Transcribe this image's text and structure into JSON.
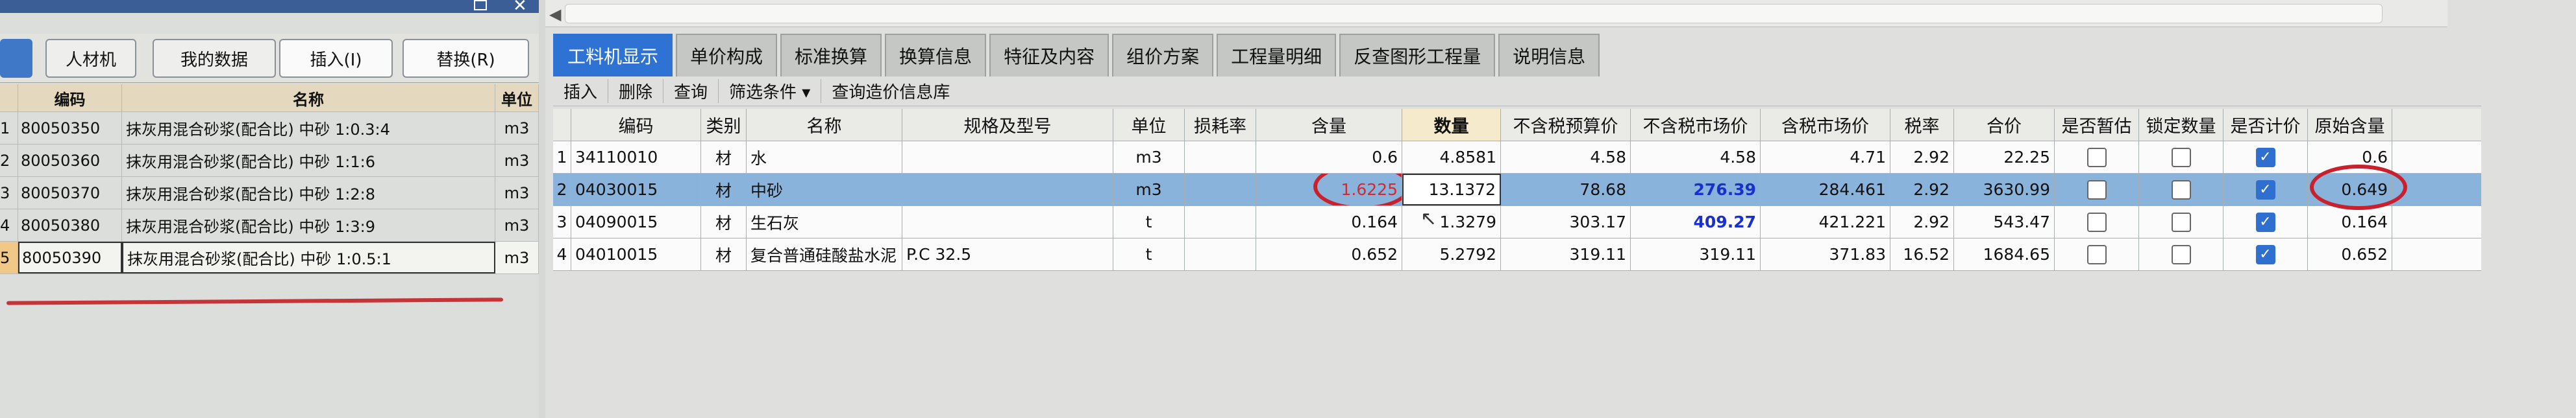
{
  "left": {
    "tabs": [
      "",
      "人材机",
      "我的数据",
      "插入(I)",
      "替换(R)"
    ],
    "columns": [
      "",
      "编码",
      "名称",
      "单位"
    ],
    "rows": [
      {
        "idx": "1",
        "code": "80050350",
        "name": "抹灰用混合砂浆(配合比) 中砂 1:0.3:4",
        "unit": "m3"
      },
      {
        "idx": "2",
        "code": "80050360",
        "name": "抹灰用混合砂浆(配合比) 中砂 1:1:6",
        "unit": "m3"
      },
      {
        "idx": "3",
        "code": "80050370",
        "name": "抹灰用混合砂浆(配合比) 中砂 1:2:8",
        "unit": "m3"
      },
      {
        "idx": "4",
        "code": "80050380",
        "name": "抹灰用混合砂浆(配合比) 中砂 1:3:9",
        "unit": "m3"
      },
      {
        "idx": "5",
        "code": "80050390",
        "name": "抹灰用混合砂浆(配合比) 中砂 1:0.5:1",
        "unit": "m3"
      }
    ]
  },
  "tabs": [
    "工料机显示",
    "单价构成",
    "标准换算",
    "换算信息",
    "特征及内容",
    "组价方案",
    "工程量明细",
    "反查图形工程量",
    "说明信息"
  ],
  "toolbar": [
    "插入",
    "删除",
    "查询",
    "筛选条件 ▾",
    "查询造价信息库"
  ],
  "columns": [
    "",
    "编码",
    "类别",
    "名称",
    "规格及型号",
    "单位",
    "损耗率",
    "含量",
    "数量",
    "不含税预算价",
    "不含税市场价",
    "含税市场价",
    "税率",
    "合价",
    "是否暂估",
    "锁定数量",
    "是否计价",
    "原始含量"
  ],
  "rows": [
    {
      "idx": "1",
      "code": "34110010",
      "type": "材",
      "name": "水",
      "spec": "",
      "unit": "m3",
      "loss": "",
      "content": "0.6",
      "qty": "4.8581",
      "pre_tax_budget": "4.58",
      "pre_tax_market": "4.58",
      "tax_market": "4.71",
      "tax_rate": "2.92",
      "total": "22.25",
      "provisional": false,
      "locked": false,
      "priced": true,
      "orig_content": "0.6"
    },
    {
      "idx": "2",
      "code": "04030015",
      "type": "材",
      "name": "中砂",
      "spec": "",
      "unit": "m3",
      "loss": "",
      "content": "1.6225",
      "qty": "13.1372",
      "pre_tax_budget": "78.68",
      "pre_tax_market": "276.39",
      "tax_market": "284.461",
      "tax_rate": "2.92",
      "total": "3630.99",
      "provisional": false,
      "locked": false,
      "priced": true,
      "orig_content": "0.649"
    },
    {
      "idx": "3",
      "code": "04090015",
      "type": "材",
      "name": "生石灰",
      "spec": "",
      "unit": "t",
      "loss": "",
      "content": "0.164",
      "qty": "1.3279",
      "pre_tax_budget": "303.17",
      "pre_tax_market": "409.27",
      "tax_market": "421.221",
      "tax_rate": "2.92",
      "total": "543.47",
      "provisional": false,
      "locked": false,
      "priced": true,
      "orig_content": "0.164"
    },
    {
      "idx": "4",
      "code": "04010015",
      "type": "材",
      "name": "复合普通硅酸盐水泥",
      "spec": "P.C 32.5",
      "unit": "t",
      "loss": "",
      "content": "0.652",
      "qty": "5.2792",
      "pre_tax_budget": "319.11",
      "pre_tax_market": "319.11",
      "tax_market": "371.83",
      "tax_rate": "16.52",
      "total": "1684.65",
      "provisional": false,
      "locked": false,
      "priced": true,
      "orig_content": "0.652"
    }
  ],
  "colors": {
    "accent_tab": "#2e73d3",
    "selected_row": "#8ab3db",
    "red_mark": "#c8202c",
    "blue_value": "#1a2fd0"
  }
}
